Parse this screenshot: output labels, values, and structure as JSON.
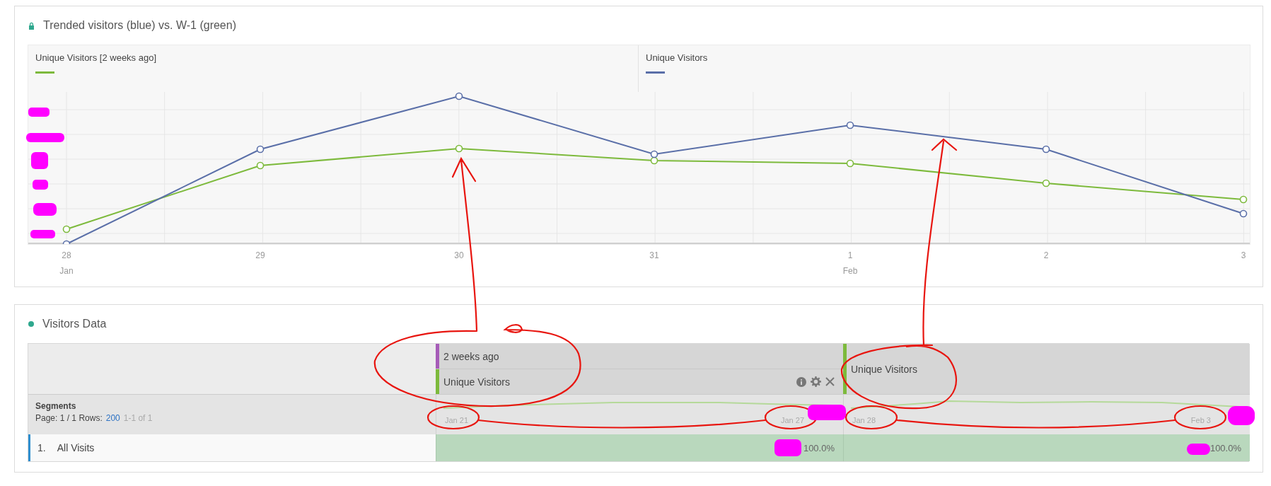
{
  "trend_panel": {
    "title": "Trended visitors (blue) vs. W-1 (green)",
    "legend": [
      {
        "label": "Unique Visitors [2 weeks ago]",
        "color": "#7dba3c"
      },
      {
        "label": "Unique Visitors",
        "color": "#5a6fa8"
      }
    ],
    "x_labels": [
      {
        "day": "28",
        "month": "Jan"
      },
      {
        "day": "29"
      },
      {
        "day": "30"
      },
      {
        "day": "31"
      },
      {
        "day": "1",
        "month": "Feb"
      },
      {
        "day": "2"
      },
      {
        "day": "3"
      }
    ]
  },
  "table_panel": {
    "title": "Visitors Data",
    "segments": {
      "title": "Segments",
      "page_text": "Page: 1 / 1 Rows:",
      "rows_link": "200",
      "range": "1-1 of 1"
    },
    "columns": [
      {
        "headers": [
          {
            "text": "2 weeks ago",
            "color": "#a65cb8"
          },
          {
            "text": "Unique Visitors",
            "color": "#7dba3c"
          }
        ],
        "date_start": "Jan 21",
        "date_end": "Jan 27"
      },
      {
        "headers": [
          {
            "text": "Unique Visitors",
            "color": "#7dba3c"
          }
        ],
        "date_start": "Jan 28",
        "date_end": "Feb 3"
      }
    ],
    "rows": [
      {
        "index": "1.",
        "label": "All Visits",
        "values": [
          "100.0%",
          "100.0%"
        ]
      }
    ]
  }
}
